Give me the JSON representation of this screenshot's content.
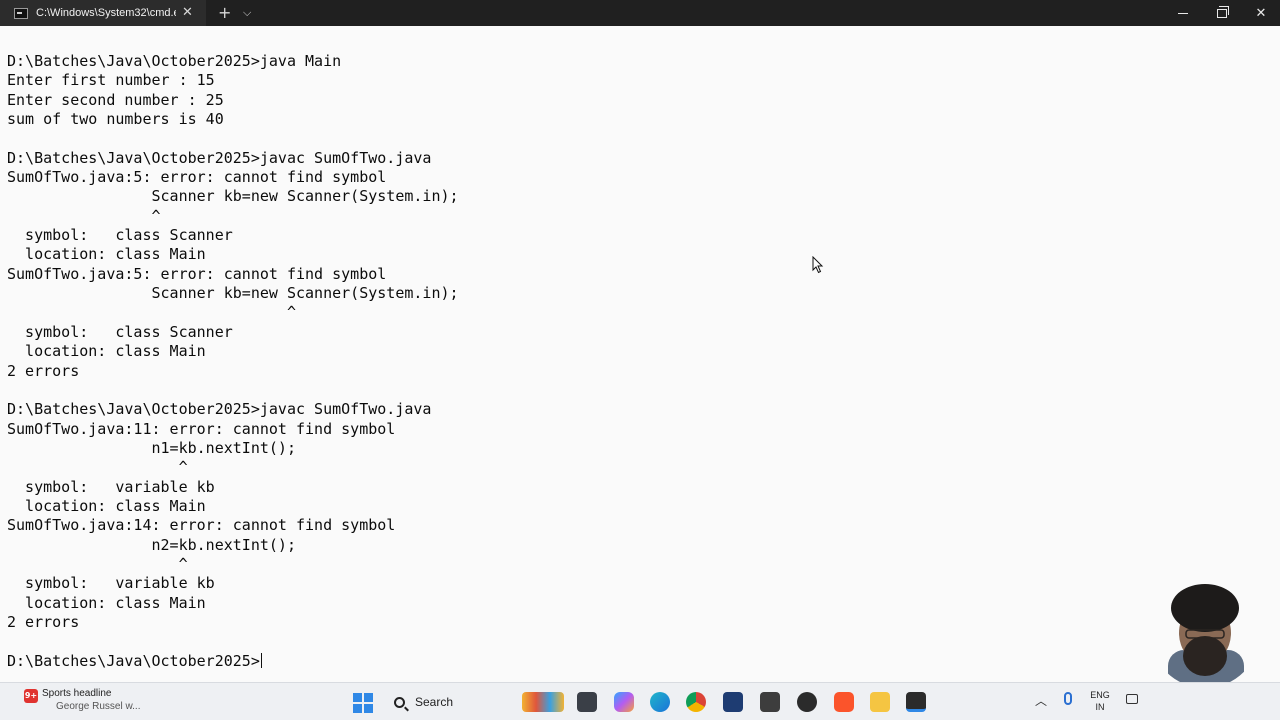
{
  "window": {
    "tab_title": "C:\\Windows\\System32\\cmd.e",
    "new_tab": "+",
    "close_tab": "✕"
  },
  "console": {
    "lines": [
      "D:\\Batches\\Java\\October2025>java Main",
      "Enter first number : 15",
      "Enter second number : 25",
      "sum of two numbers is 40",
      "",
      "D:\\Batches\\Java\\October2025>javac SumOfTwo.java",
      "SumOfTwo.java:5: error: cannot find symbol",
      "                Scanner kb=new Scanner(System.in);",
      "                ^",
      "  symbol:   class Scanner",
      "  location: class Main",
      "SumOfTwo.java:5: error: cannot find symbol",
      "                Scanner kb=new Scanner(System.in);",
      "                               ^",
      "  symbol:   class Scanner",
      "  location: class Main",
      "2 errors",
      "",
      "D:\\Batches\\Java\\October2025>javac SumOfTwo.java",
      "SumOfTwo.java:11: error: cannot find symbol",
      "                n1=kb.nextInt();",
      "                   ^",
      "  symbol:   variable kb",
      "  location: class Main",
      "SumOfTwo.java:14: error: cannot find symbol",
      "                n2=kb.nextInt();",
      "                   ^",
      "  symbol:   variable kb",
      "  location: class Main",
      "2 errors",
      "",
      "D:\\Batches\\Java\\October2025>"
    ]
  },
  "taskbar": {
    "weather_badge": "9+",
    "weather_title": "Sports headline",
    "weather_sub": "George Russel w...",
    "search_label": "Search",
    "lang_top": "ENG",
    "lang_bottom": "IN"
  },
  "colors": {
    "console_bg": "#fafafa",
    "console_fg": "#0c0c0c",
    "titlebar_bg": "#202020",
    "taskbar_bg": "#eef0f3",
    "accent": "#2f88e6"
  }
}
